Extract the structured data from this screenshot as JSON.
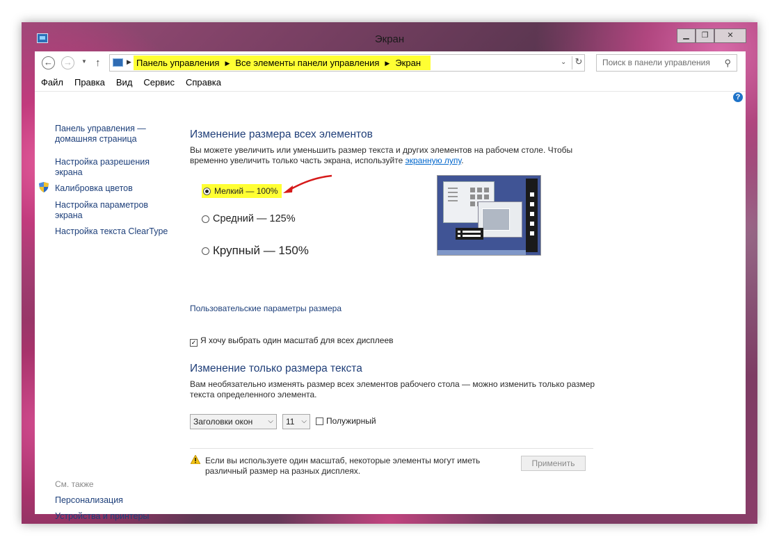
{
  "window": {
    "title": "Экран",
    "minimize_glyph": "▁",
    "maximize_glyph": "❐",
    "close_glyph": "✕"
  },
  "address": {
    "crumbs": [
      "Панель управления",
      "Все элементы панели управления",
      "Экран"
    ],
    "search_placeholder": "Поиск в панели управления"
  },
  "menu": [
    "Файл",
    "Правка",
    "Вид",
    "Сервис",
    "Справка"
  ],
  "sidebar": {
    "links": [
      "Панель управления — домашняя страница",
      "Настройка разрешения экрана",
      "Калибровка цветов",
      "Настройка параметров экрана",
      "Настройка текста ClearType"
    ],
    "see_also_heading": "См. также",
    "see_also": [
      "Персонализация",
      "Устройства и принтеры"
    ]
  },
  "main": {
    "heading1": "Изменение размера всех элементов",
    "para1_text": "Вы можете увеличить или уменьшить размер текста и других элементов на рабочем столе. Чтобы временно увеличить только часть экрана, используйте ",
    "para1_link": "экранную лупу",
    "para1_end": ".",
    "radios": [
      {
        "label": "Мелкий — 100%",
        "selected": true
      },
      {
        "label": "Средний — 125%",
        "selected": false
      },
      {
        "label": "Крупный — 150%",
        "selected": false
      }
    ],
    "custom_link": "Пользовательские параметры размера",
    "one_scale_label": "Я хочу выбрать один масштаб для всех дисплеев",
    "one_scale_checked": true,
    "heading2": "Изменение только размера текста",
    "para2": "Вам необязательно изменять размер всех элементов рабочего стола — можно изменить только размер текста определенного элемента.",
    "element_select": "Заголовки окон",
    "size_select": "11",
    "bold_label": "Полужирный",
    "bold_checked": false,
    "warning": "Если вы используете один масштаб, некоторые элементы могут иметь различный размер на разных дисплеях.",
    "apply_label": "Применить"
  },
  "colors": {
    "highlight": "#ffff33",
    "link": "#1d3f7a",
    "heading": "#1f3e78",
    "annotation_arrow": "#d61a1a"
  }
}
